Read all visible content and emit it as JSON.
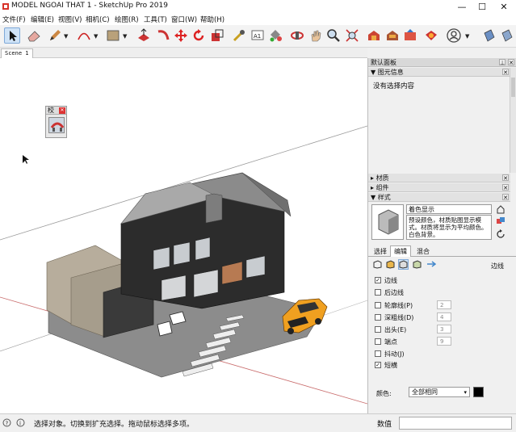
{
  "window": {
    "title": "MODEL NGOAI THAT 1 - SketchUp Pro 2019",
    "minimize": "—",
    "maximize": "☐",
    "close": "✕"
  },
  "menu": [
    "文件(F)",
    "编辑(E)",
    "视图(V)",
    "相机(C)",
    "绘图(R)",
    "工具(T)",
    "窗口(W)",
    "帮助(H)"
  ],
  "scene": {
    "tab": "Scene 1"
  },
  "float_panel": {
    "title": "校"
  },
  "tray": {
    "title": "默认面板",
    "entity_info": {
      "header": "图元信息",
      "content": "没有选择内容"
    },
    "materials": {
      "header": "材质"
    },
    "components": {
      "header": "组件"
    },
    "styles": {
      "header": "样式",
      "name": "着色显示",
      "description": "预设颜色，材质贴图显示模式。材质将显示为平均颜色。白色背景。",
      "tabs": [
        "选择",
        "编辑",
        "混合"
      ],
      "section_label": "边线",
      "options": [
        {
          "label": "边线",
          "checked": true
        },
        {
          "label": "后边线",
          "checked": false
        },
        {
          "label": "轮廓线(P)",
          "checked": false,
          "value": "2"
        },
        {
          "label": "深粗线(D)",
          "checked": false,
          "value": "4"
        },
        {
          "label": "出头(E)",
          "checked": false,
          "value": "3"
        },
        {
          "label": "端点",
          "checked": false,
          "value": "9"
        },
        {
          "label": "抖动(J)",
          "checked": false
        },
        {
          "label": "短横",
          "checked": true
        }
      ],
      "color_label": "颜色:",
      "color_value": "全部相同"
    }
  },
  "status": {
    "message": "选择对象。切换到扩充选择。拖动鼠标选择多项。",
    "measurement_label": "数值"
  },
  "colors": {
    "accent": "#cfe3f7",
    "edge_color": "#000000"
  }
}
